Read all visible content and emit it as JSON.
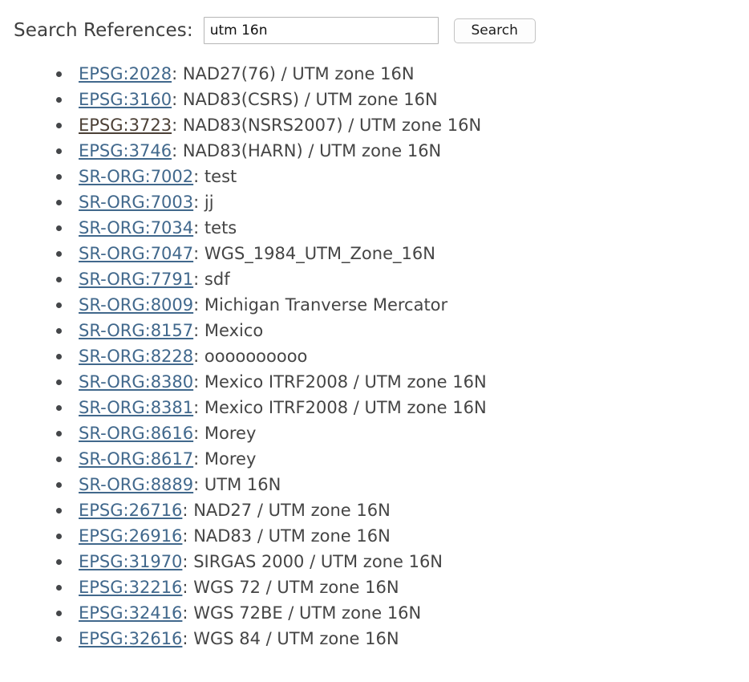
{
  "search": {
    "label": "Search References:",
    "value": "utm 16n",
    "placeholder": "",
    "button_label": "Search"
  },
  "colors": {
    "link": "#41688c",
    "link_visited": "#4c4036",
    "text": "#454545",
    "label": "#3f3f3f",
    "input_border": "#b6b6b6",
    "button_border": "#c3c3c3",
    "bullet": "#444649",
    "background": "#ffffff"
  },
  "results": [
    {
      "code": "EPSG:2028",
      "separator": ": ",
      "name": "NAD27(76) / UTM zone 16N",
      "visited": false
    },
    {
      "code": "EPSG:3160",
      "separator": ": ",
      "name": "NAD83(CSRS) / UTM zone 16N",
      "visited": false
    },
    {
      "code": "EPSG:3723",
      "separator": ": ",
      "name": "NAD83(NSRS2007) / UTM zone 16N",
      "visited": true
    },
    {
      "code": "EPSG:3746",
      "separator": ": ",
      "name": "NAD83(HARN) / UTM zone 16N",
      "visited": false
    },
    {
      "code": "SR-ORG:7002",
      "separator": ": ",
      "name": "test",
      "visited": false
    },
    {
      "code": "SR-ORG:7003",
      "separator": ": ",
      "name": "jj",
      "visited": false
    },
    {
      "code": "SR-ORG:7034",
      "separator": ": ",
      "name": "tets",
      "visited": false
    },
    {
      "code": "SR-ORG:7047",
      "separator": ": ",
      "name": "WGS_1984_UTM_Zone_16N",
      "visited": false
    },
    {
      "code": "SR-ORG:7791",
      "separator": ": ",
      "name": "sdf",
      "visited": false
    },
    {
      "code": "SR-ORG:8009",
      "separator": ": ",
      "name": "Michigan Tranverse Mercator",
      "visited": false
    },
    {
      "code": "SR-ORG:8157",
      "separator": ": ",
      "name": "Mexico",
      "visited": false
    },
    {
      "code": "SR-ORG:8228",
      "separator": ": ",
      "name": "oooooooooo",
      "visited": false
    },
    {
      "code": "SR-ORG:8380",
      "separator": ": ",
      "name": "Mexico ITRF2008 / UTM zone 16N",
      "visited": false
    },
    {
      "code": "SR-ORG:8381",
      "separator": ": ",
      "name": "Mexico ITRF2008 / UTM zone 16N",
      "visited": false
    },
    {
      "code": "SR-ORG:8616",
      "separator": ": ",
      "name": "Morey",
      "visited": false
    },
    {
      "code": "SR-ORG:8617",
      "separator": ": ",
      "name": "Morey",
      "visited": false
    },
    {
      "code": "SR-ORG:8889",
      "separator": ": ",
      "name": "UTM 16N",
      "visited": false
    },
    {
      "code": "EPSG:26716",
      "separator": ": ",
      "name": "NAD27 / UTM zone 16N",
      "visited": false
    },
    {
      "code": "EPSG:26916",
      "separator": ": ",
      "name": "NAD83 / UTM zone 16N",
      "visited": false
    },
    {
      "code": "EPSG:31970",
      "separator": ": ",
      "name": "SIRGAS 2000 / UTM zone 16N",
      "visited": false
    },
    {
      "code": "EPSG:32216",
      "separator": ": ",
      "name": "WGS 72 / UTM zone 16N",
      "visited": false
    },
    {
      "code": "EPSG:32416",
      "separator": ": ",
      "name": "WGS 72BE / UTM zone 16N",
      "visited": false
    },
    {
      "code": "EPSG:32616",
      "separator": ": ",
      "name": "WGS 84 / UTM zone 16N",
      "visited": false
    }
  ]
}
